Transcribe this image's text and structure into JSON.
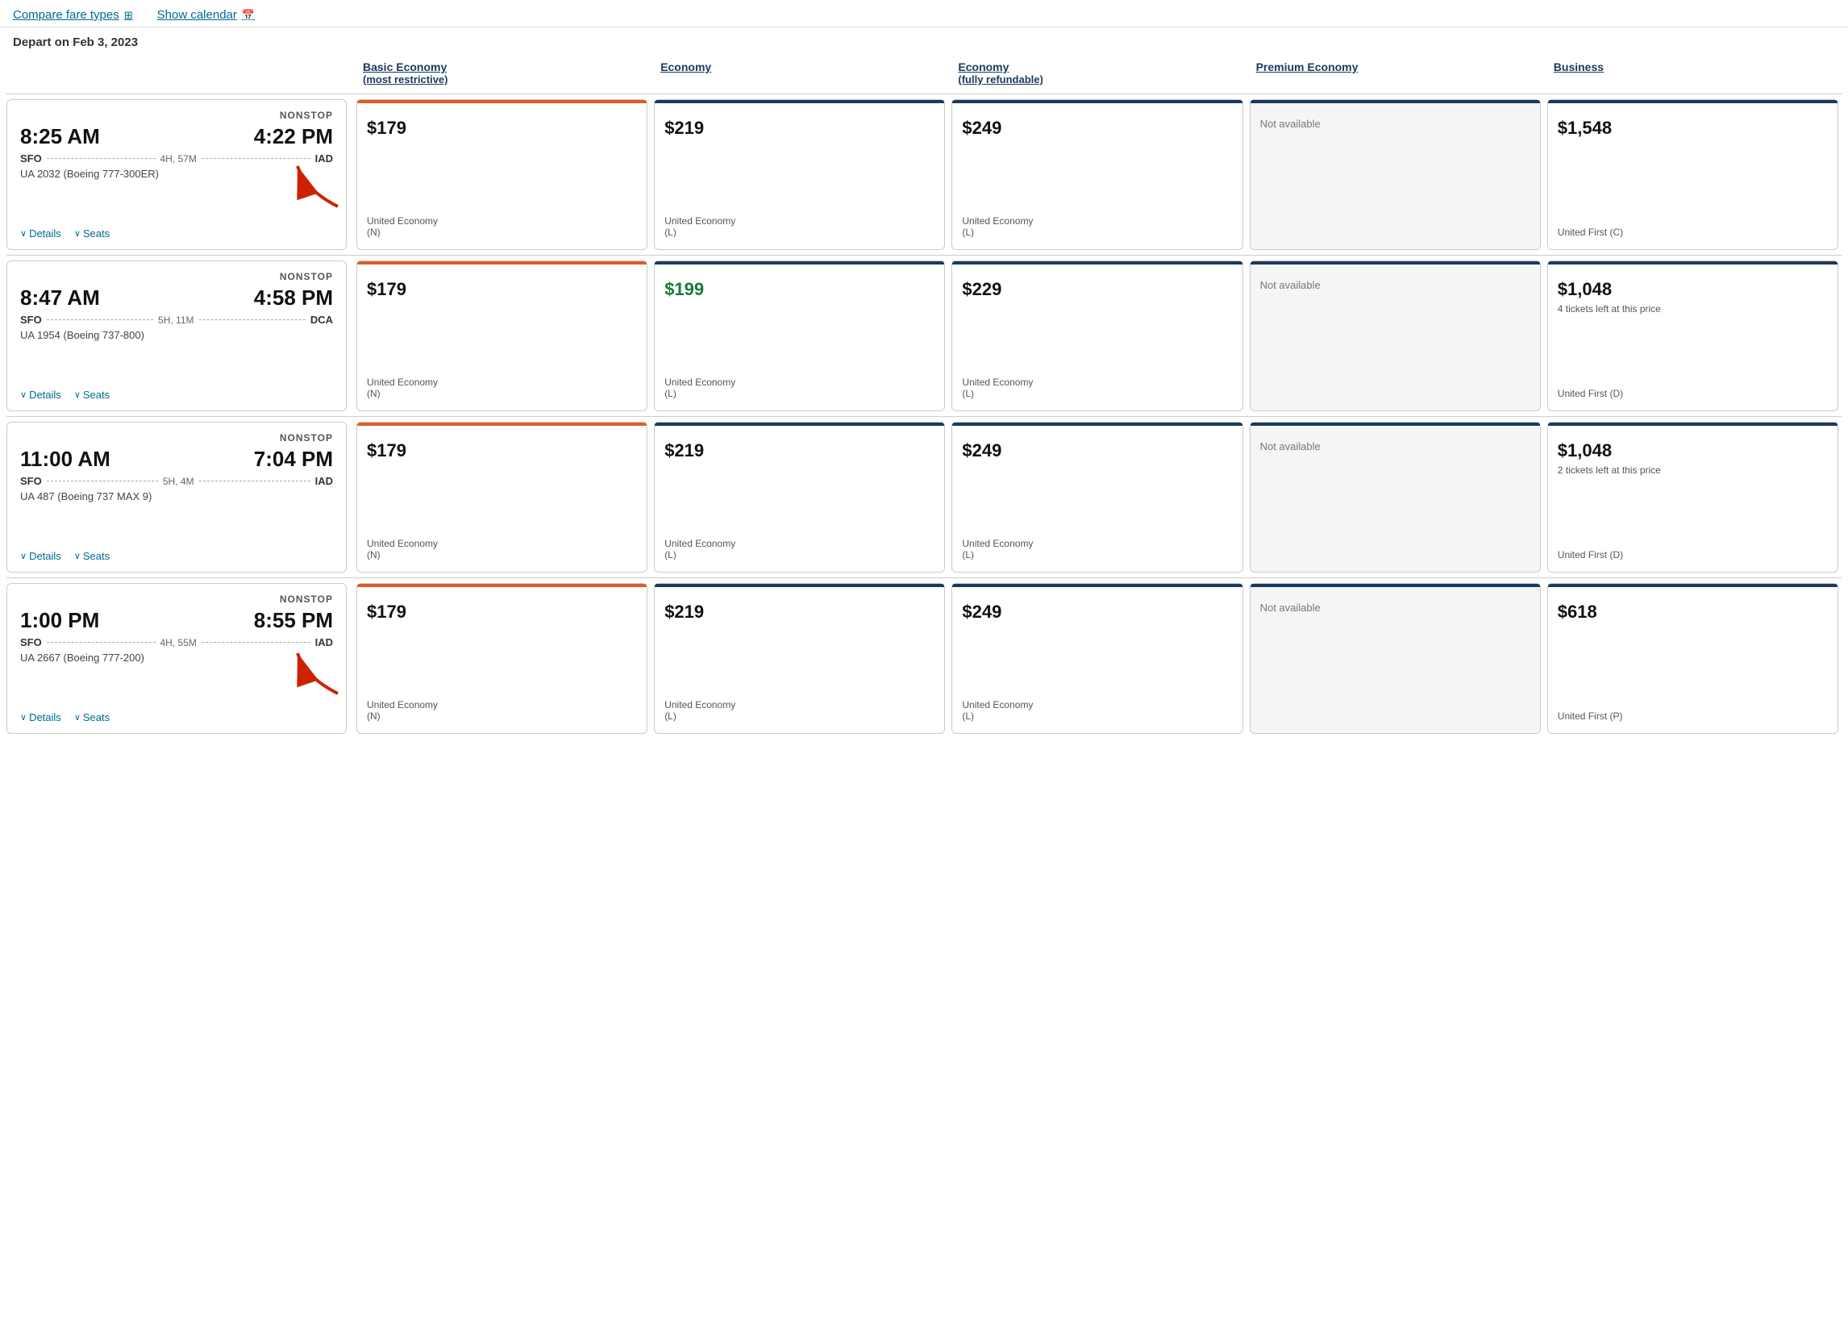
{
  "topLinks": {
    "compareFare": "Compare fare types",
    "showCalendar": "Show calendar"
  },
  "departLabel": "Depart on Feb 3, 2023",
  "columnHeaders": [
    {
      "id": "empty",
      "label": "",
      "sub": ""
    },
    {
      "id": "basic-economy",
      "label": "Basic Economy",
      "sub": "(most restrictive)"
    },
    {
      "id": "economy",
      "label": "Economy",
      "sub": ""
    },
    {
      "id": "economy-refundable",
      "label": "Economy",
      "sub": "(fully refundable)"
    },
    {
      "id": "premium-economy",
      "label": "Premium Economy",
      "sub": ""
    },
    {
      "id": "business",
      "label": "Business",
      "sub": ""
    }
  ],
  "flights": [
    {
      "nonstop": "NONSTOP",
      "depart": "8:25 AM",
      "arrive": "4:22 PM",
      "origin": "SFO",
      "dest": "IAD",
      "duration": "4H, 57M",
      "aircraft": "UA 2032 (Boeing 777-300ER)",
      "fares": [
        {
          "price": "$179",
          "sub": "United Economy\n(N)",
          "topBar": "orange",
          "green": false,
          "notAvailable": false,
          "tickets": ""
        },
        {
          "price": "$219",
          "sub": "United Economy\n(L)",
          "topBar": "dark",
          "green": false,
          "notAvailable": false,
          "tickets": ""
        },
        {
          "price": "$249",
          "sub": "United Economy\n(L)",
          "topBar": "dark",
          "green": false,
          "notAvailable": false,
          "tickets": ""
        },
        {
          "price": "",
          "sub": "",
          "topBar": "dark",
          "green": false,
          "notAvailable": true,
          "tickets": ""
        },
        {
          "price": "$1,548",
          "sub": "United First (C)",
          "topBar": "dark",
          "green": false,
          "notAvailable": false,
          "tickets": ""
        }
      ]
    },
    {
      "nonstop": "NONSTOP",
      "depart": "8:47 AM",
      "arrive": "4:58 PM",
      "origin": "SFO",
      "dest": "DCA",
      "duration": "5H, 11M",
      "aircraft": "UA 1954 (Boeing 737-800)",
      "fares": [
        {
          "price": "$179",
          "sub": "United Economy\n(N)",
          "topBar": "orange",
          "green": false,
          "notAvailable": false,
          "tickets": ""
        },
        {
          "price": "$199",
          "sub": "United Economy\n(L)",
          "topBar": "dark",
          "green": true,
          "notAvailable": false,
          "tickets": ""
        },
        {
          "price": "$229",
          "sub": "United Economy\n(L)",
          "topBar": "dark",
          "green": false,
          "notAvailable": false,
          "tickets": ""
        },
        {
          "price": "",
          "sub": "",
          "topBar": "dark",
          "green": false,
          "notAvailable": true,
          "tickets": ""
        },
        {
          "price": "$1,048",
          "sub": "United First (D)",
          "topBar": "dark",
          "green": false,
          "notAvailable": false,
          "tickets": "4 tickets left at this price"
        }
      ]
    },
    {
      "nonstop": "NONSTOP",
      "depart": "11:00 AM",
      "arrive": "7:04 PM",
      "origin": "SFO",
      "dest": "IAD",
      "duration": "5H, 4M",
      "aircraft": "UA 487 (Boeing 737 MAX 9)",
      "fares": [
        {
          "price": "$179",
          "sub": "United Economy\n(N)",
          "topBar": "orange",
          "green": false,
          "notAvailable": false,
          "tickets": ""
        },
        {
          "price": "$219",
          "sub": "United Economy\n(L)",
          "topBar": "dark",
          "green": false,
          "notAvailable": false,
          "tickets": ""
        },
        {
          "price": "$249",
          "sub": "United Economy\n(L)",
          "topBar": "dark",
          "green": false,
          "notAvailable": false,
          "tickets": ""
        },
        {
          "price": "",
          "sub": "",
          "topBar": "dark",
          "green": false,
          "notAvailable": true,
          "tickets": ""
        },
        {
          "price": "$1,048",
          "sub": "United First (D)",
          "topBar": "dark",
          "green": false,
          "notAvailable": false,
          "tickets": "2 tickets left at this price"
        }
      ]
    },
    {
      "nonstop": "NONSTOP",
      "depart": "1:00 PM",
      "arrive": "8:55 PM",
      "origin": "SFO",
      "dest": "IAD",
      "duration": "4H, 55M",
      "aircraft": "UA 2667 (Boeing 777-200)",
      "fares": [
        {
          "price": "$179",
          "sub": "United Economy\n(N)",
          "topBar": "orange",
          "green": false,
          "notAvailable": false,
          "tickets": ""
        },
        {
          "price": "$219",
          "sub": "United Economy\n(L)",
          "topBar": "dark",
          "green": false,
          "notAvailable": false,
          "tickets": ""
        },
        {
          "price": "$249",
          "sub": "United Economy\n(L)",
          "topBar": "dark",
          "green": false,
          "notAvailable": false,
          "tickets": ""
        },
        {
          "price": "",
          "sub": "",
          "topBar": "dark",
          "green": false,
          "notAvailable": true,
          "tickets": ""
        },
        {
          "price": "$618",
          "sub": "United First (P)",
          "topBar": "dark",
          "green": false,
          "notAvailable": false,
          "tickets": ""
        }
      ]
    }
  ],
  "labels": {
    "details": "Details",
    "seats": "Seats",
    "notAvailable": "Not available"
  }
}
